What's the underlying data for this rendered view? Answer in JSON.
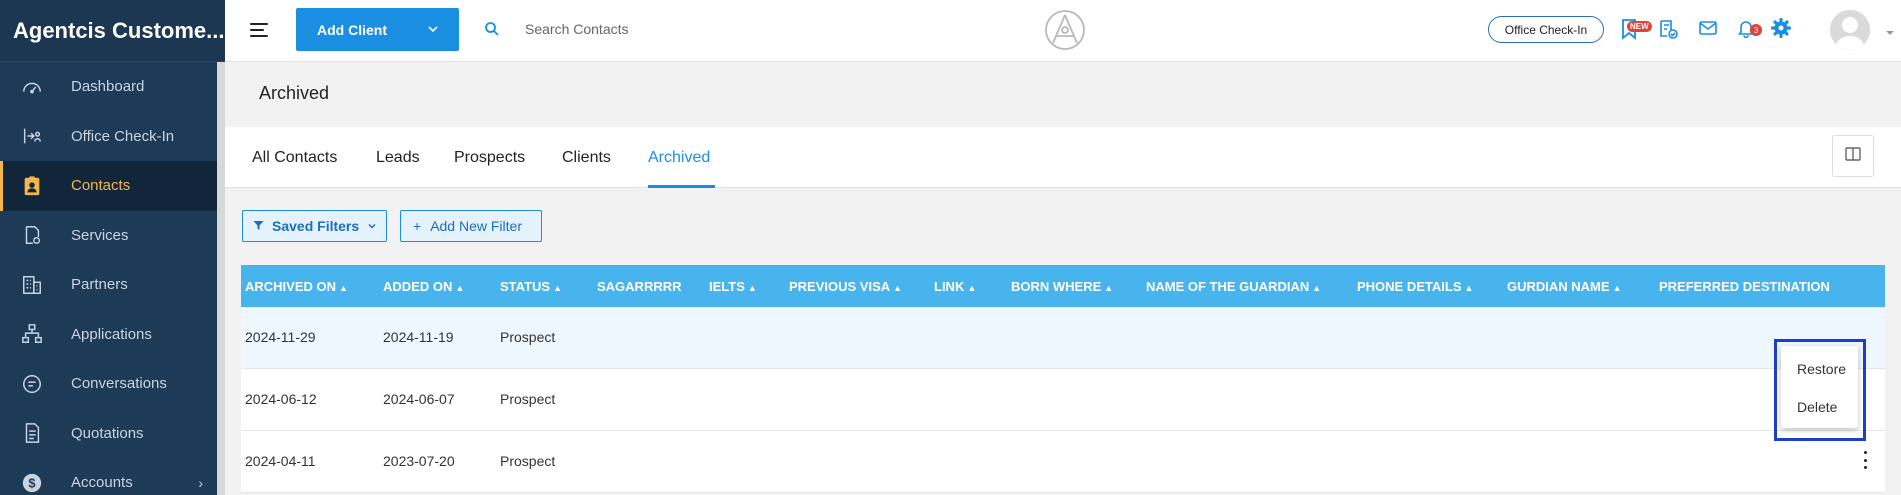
{
  "app": {
    "title": "Agentcis Custome..."
  },
  "sidebar": {
    "items": [
      {
        "label": "Dashboard",
        "icon": "speedometer-icon"
      },
      {
        "label": "Office Check-In",
        "icon": "checkin-icon"
      },
      {
        "label": "Contacts",
        "icon": "contact-card-icon",
        "active": true
      },
      {
        "label": "Services",
        "icon": "services-icon"
      },
      {
        "label": "Partners",
        "icon": "building-icon"
      },
      {
        "label": "Applications",
        "icon": "flow-icon"
      },
      {
        "label": "Conversations",
        "icon": "chat-icon"
      },
      {
        "label": "Quotations",
        "icon": "document-icon"
      },
      {
        "label": "Accounts",
        "icon": "dollar-icon"
      }
    ]
  },
  "topbar": {
    "add_client_label": "Add Client",
    "search_placeholder": "Search Contacts",
    "office_checkin_label": "Office Check-In",
    "new_badge": "NEW",
    "notification_count": "3"
  },
  "page": {
    "title": "Archived"
  },
  "tabs": [
    {
      "label": "All Contacts"
    },
    {
      "label": "Leads"
    },
    {
      "label": "Prospects"
    },
    {
      "label": "Clients"
    },
    {
      "label": "Archived",
      "active": true
    }
  ],
  "filters": {
    "saved_filters_label": "Saved Filters",
    "add_filter_label": "Add New Filter"
  },
  "table": {
    "columns": [
      {
        "label": "ARCHIVED ON",
        "sortable": true
      },
      {
        "label": "ADDED ON",
        "sortable": true
      },
      {
        "label": "STATUS",
        "sortable": true
      },
      {
        "label": "SAGARRRRR",
        "sortable": false
      },
      {
        "label": "IELTS",
        "sortable": true
      },
      {
        "label": "PREVIOUS VISA",
        "sortable": true
      },
      {
        "label": "LINK",
        "sortable": true
      },
      {
        "label": "BORN WHERE",
        "sortable": true
      },
      {
        "label": "NAME OF THE GUARDIAN",
        "sortable": true
      },
      {
        "label": "PHONE DETAILS",
        "sortable": true
      },
      {
        "label": "GURDIAN NAME",
        "sortable": true
      },
      {
        "label": "PREFERRED DESTINATION",
        "sortable": false
      }
    ],
    "rows": [
      {
        "archived_on": "2024-11-29",
        "added_on": "2024-11-19",
        "status": "Prospect"
      },
      {
        "archived_on": "2024-06-12",
        "added_on": "2024-06-07",
        "status": "Prospect"
      },
      {
        "archived_on": "2024-04-11",
        "added_on": "2023-07-20",
        "status": "Prospect"
      }
    ]
  },
  "context_menu": {
    "items": [
      {
        "label": "Restore"
      },
      {
        "label": "Delete"
      }
    ]
  },
  "colors": {
    "sidebar_bg": "#1d3a57",
    "accent_blue": "#1a8ee0",
    "table_header": "#47b4ee",
    "active_nav": "#f5b64a",
    "badge_red": "#e0423c"
  }
}
